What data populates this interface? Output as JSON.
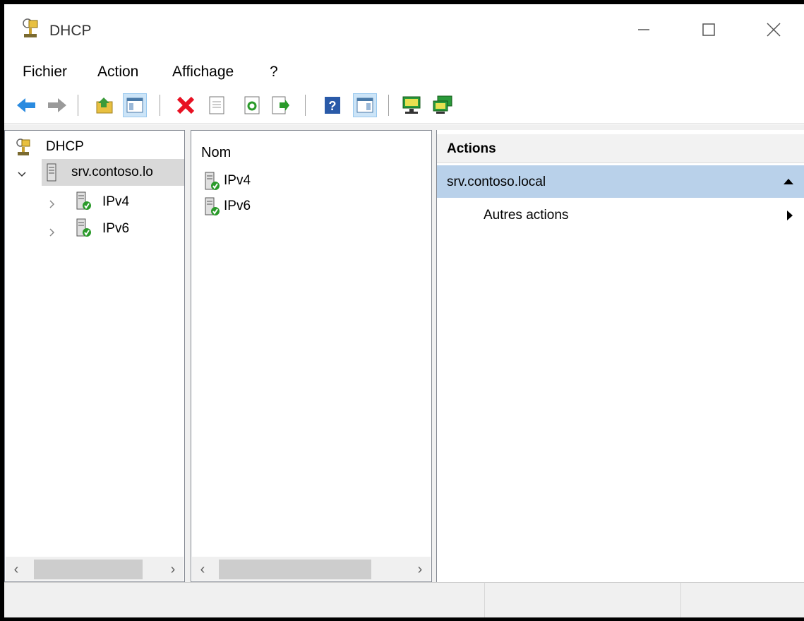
{
  "window": {
    "title": "DHCP"
  },
  "menu": {
    "items": [
      "Fichier",
      "Action",
      "Affichage",
      "?"
    ]
  },
  "toolbar": {
    "buttons": [
      "back-icon",
      "forward-icon",
      "up-folder-icon",
      "show-tree-icon",
      "delete-icon",
      "properties-icon",
      "refresh-icon",
      "export-icon",
      "help-icon",
      "show-action-pane-icon",
      "server-icon",
      "server-network-icon"
    ]
  },
  "tree": {
    "root_label": "DHCP",
    "server_label": "srv.contoso.lo",
    "children": [
      {
        "label": "IPv4"
      },
      {
        "label": "IPv6"
      }
    ]
  },
  "list": {
    "column_header": "Nom",
    "items": [
      {
        "label": "IPv4"
      },
      {
        "label": "IPv6"
      }
    ]
  },
  "actions": {
    "header": "Actions",
    "group_title": "srv.contoso.local",
    "items": [
      {
        "label": "Autres actions"
      }
    ]
  },
  "colors": {
    "selection": "#b9d1ea",
    "tree_selected": "#d9d9d9",
    "delete_red": "#e81123"
  }
}
